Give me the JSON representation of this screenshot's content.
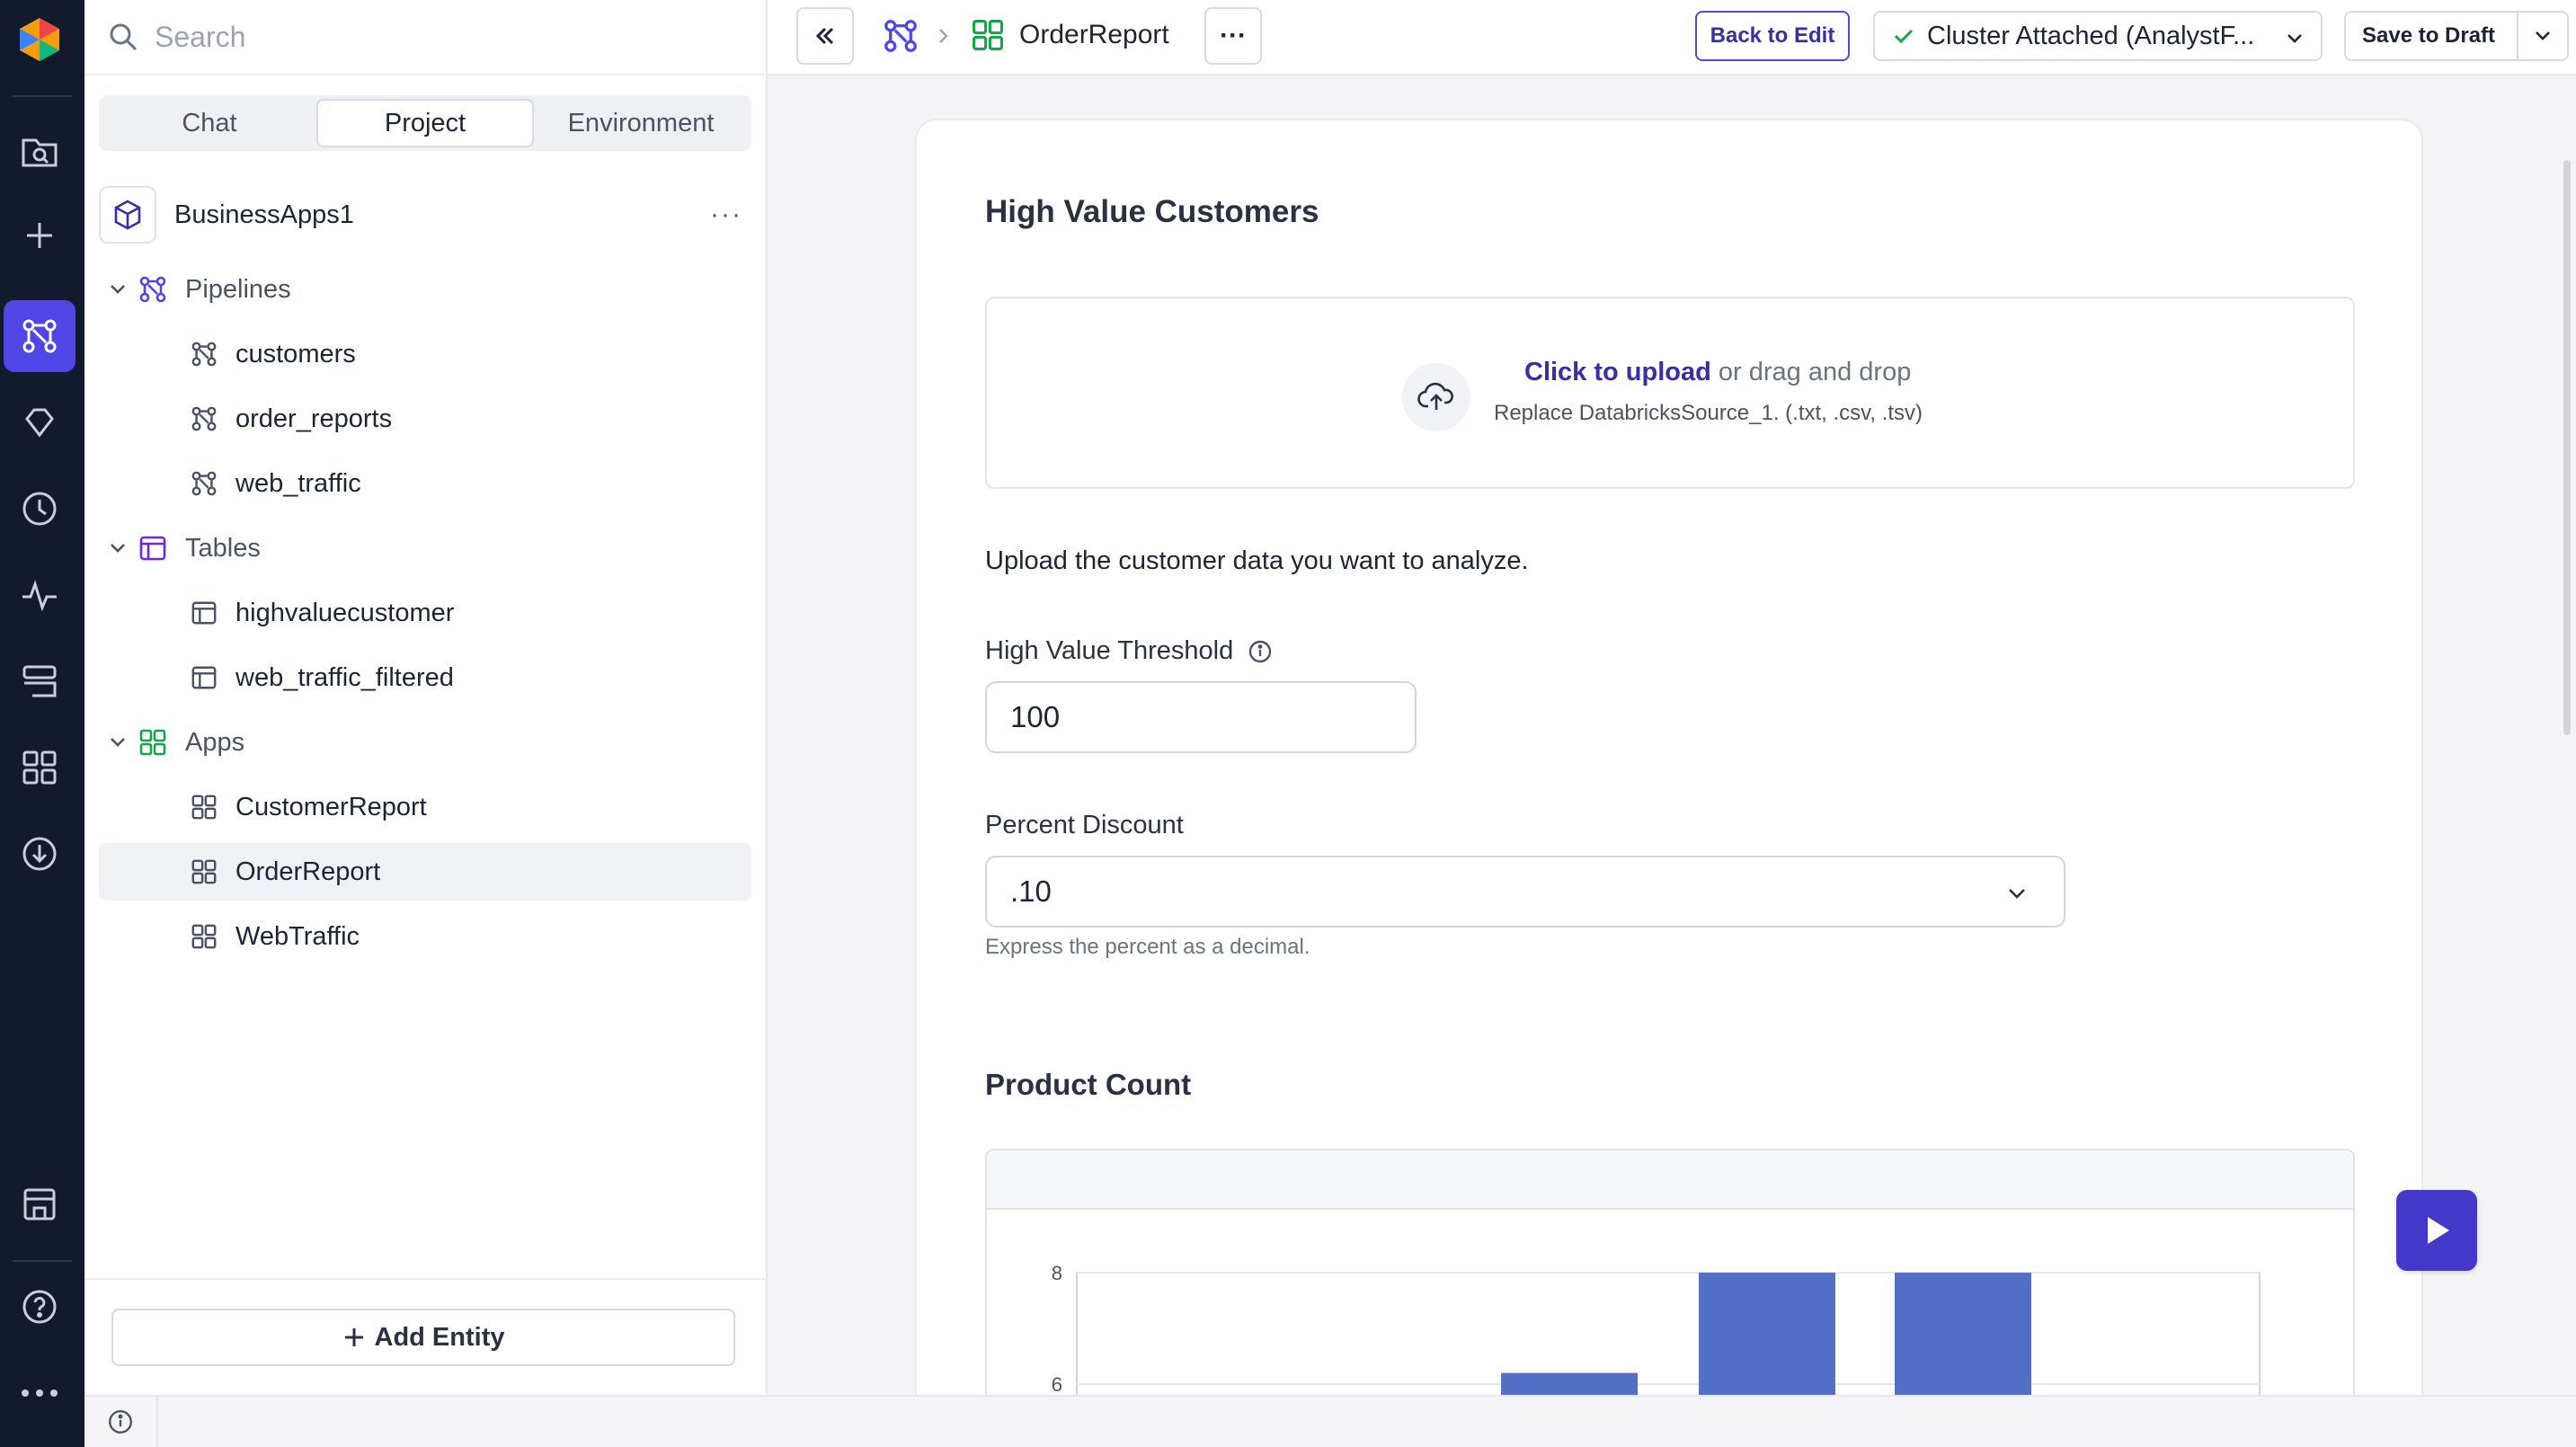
{
  "search": {
    "placeholder": "Search"
  },
  "sidebar": {
    "tabs": [
      "Chat",
      "Project",
      "Environment"
    ],
    "active_tab": "Project",
    "project": {
      "name": "BusinessApps1",
      "more": "···"
    },
    "groups": [
      {
        "label": "Pipelines",
        "items": [
          "customers",
          "order_reports",
          "web_traffic"
        ]
      },
      {
        "label": "Tables",
        "items": [
          "highvaluecustomer",
          "web_traffic_filtered"
        ]
      },
      {
        "label": "Apps",
        "items": [
          "CustomerReport",
          "OrderReport",
          "WebTraffic"
        ]
      }
    ],
    "selected_item": "OrderReport",
    "add_entity": "Add Entity"
  },
  "topbar": {
    "breadcrumb_current": "OrderReport",
    "more": "···",
    "back_to_edit": "Back to Edit",
    "cluster": "Cluster Attached (AnalystF...",
    "save_to_draft": "Save to Draft"
  },
  "card": {
    "title": "High Value Customers",
    "upload": {
      "link": "Click to upload",
      "rest": " or drag and drop",
      "hint": "Replace DatabricksSource_1. (.txt, .csv, .tsv)"
    },
    "upload_description": "Upload the customer data you want to analyze.",
    "threshold": {
      "label": "High Value Threshold",
      "value": "100"
    },
    "percent_discount": {
      "label": "Percent Discount",
      "value": ".10",
      "help": "Express the percent as a decimal."
    },
    "product_count_title": "Product Count"
  },
  "colors": {
    "accent": "#4f46e5",
    "rail": "#141a2e",
    "bar": "#5470c6",
    "apps_green": "#16a34a"
  },
  "chart_data": {
    "type": "bar",
    "title": "",
    "visible_y_ticks": [
      8,
      6
    ],
    "ylim_visible": [
      6,
      8
    ],
    "bars_visible": [
      {
        "index": 0,
        "value": 6.2
      },
      {
        "index": 1,
        "value": 8
      },
      {
        "index": 2,
        "value": 8
      }
    ]
  }
}
